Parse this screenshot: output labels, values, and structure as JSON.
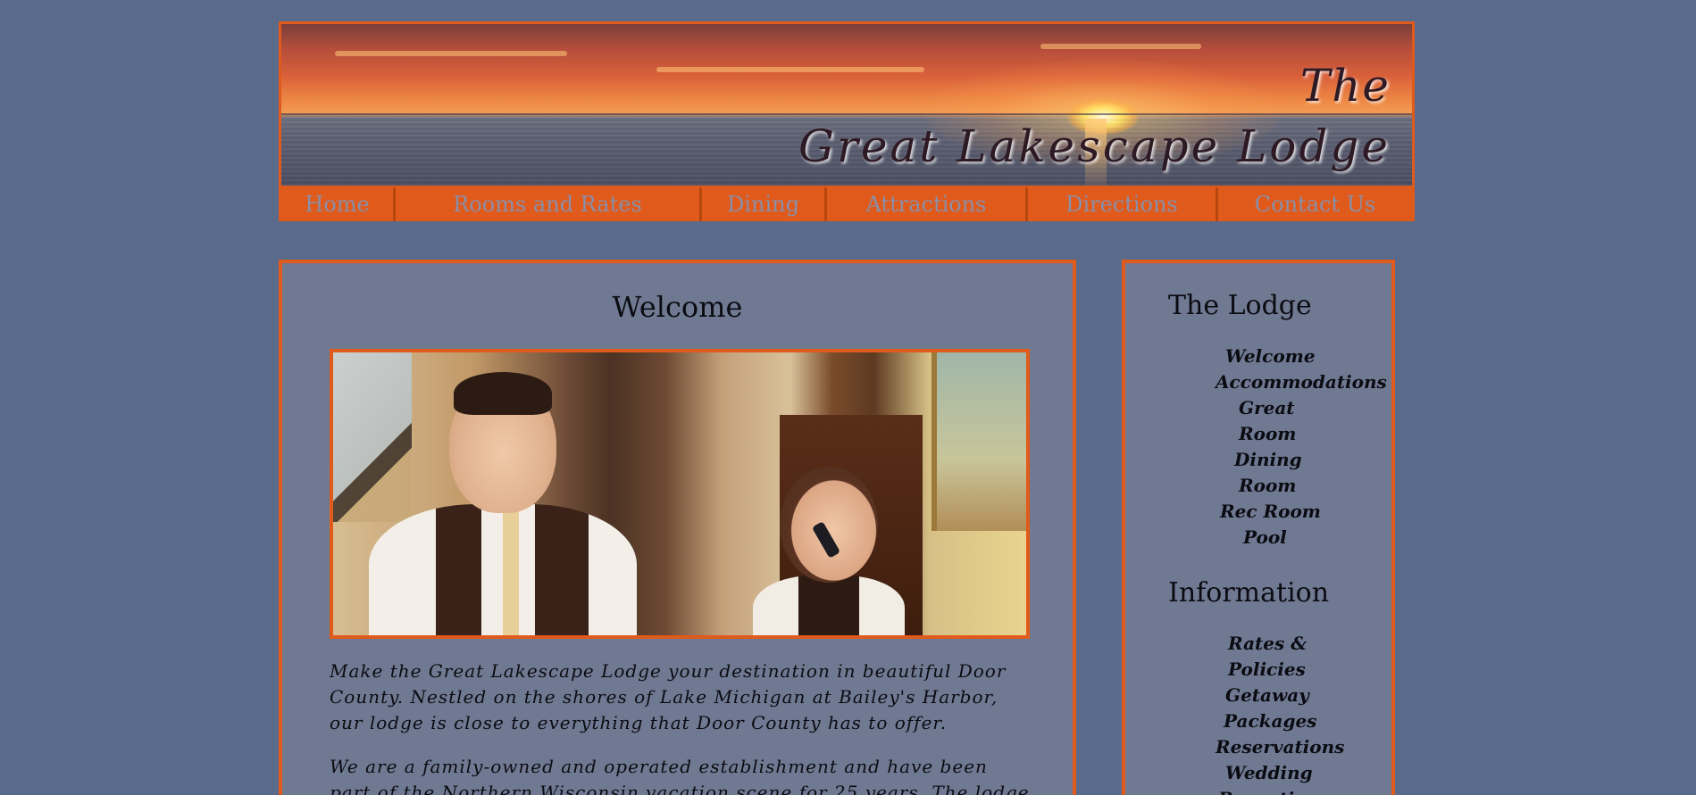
{
  "header": {
    "brand_line1": "The",
    "brand_line2": "Great Lakescape Lodge"
  },
  "nav": {
    "items": [
      {
        "label": "Home"
      },
      {
        "label": "Rooms and Rates"
      },
      {
        "label": "Dining"
      },
      {
        "label": "Attractions"
      },
      {
        "label": "Directions"
      },
      {
        "label": "Contact Us"
      }
    ]
  },
  "main": {
    "title": "Welcome",
    "paragraphs": [
      "Make the Great Lakescape Lodge your destination in beautiful Door County. Nestled on the shores of Lake Michigan at Bailey's Harbor, our lodge is close to everything that Door County has to offer.",
      "We are a family-owned and operated establishment and have been part of the Northern Wisconsin vacation scene for 25 years. The lodge is a"
    ]
  },
  "sidebar": {
    "lodge_heading": "The Lodge",
    "lodge_links": [
      {
        "label": "Welcome"
      },
      {
        "label": "Accommodations"
      },
      {
        "label": "Great"
      },
      {
        "label": "Room"
      },
      {
        "label": "Dining"
      },
      {
        "label": "Room"
      },
      {
        "label": "Rec Room"
      },
      {
        "label": "Pool"
      }
    ],
    "info_heading": "Information",
    "info_links": [
      {
        "label": "Rates &"
      },
      {
        "label": "Policies"
      },
      {
        "label": "Getaway"
      },
      {
        "label": "Packages"
      },
      {
        "label": "Reservations"
      },
      {
        "label": "Wedding"
      },
      {
        "label": "Reception"
      }
    ]
  },
  "colors": {
    "page_background": "#5a6a8a",
    "panel_background": "#6f7a92",
    "accent_orange": "#e05a1c",
    "nav_text": "#8a8fa8"
  }
}
